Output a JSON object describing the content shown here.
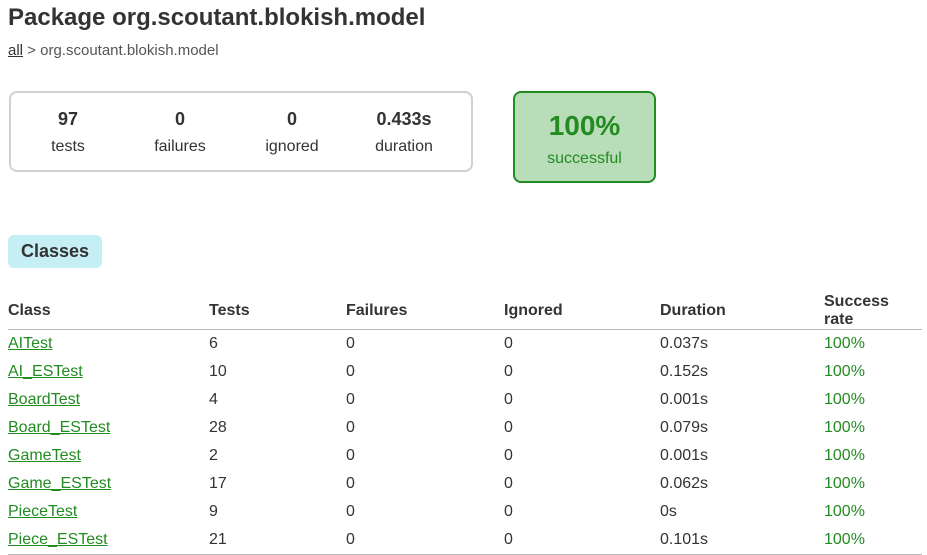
{
  "page": {
    "title": "Package org.scoutant.blokish.model",
    "breadcrumb": {
      "link": "all",
      "separator": " > ",
      "current": "org.scoutant.blokish.model"
    }
  },
  "summary": {
    "tests": {
      "value": "97",
      "label": "tests"
    },
    "failures": {
      "value": "0",
      "label": "failures"
    },
    "ignored": {
      "value": "0",
      "label": "ignored"
    },
    "duration": {
      "value": "0.433s",
      "label": "duration"
    },
    "success": {
      "value": "100%",
      "label": "successful"
    }
  },
  "tabs": [
    {
      "label": "Classes"
    }
  ],
  "table": {
    "headers": [
      "Class",
      "Tests",
      "Failures",
      "Ignored",
      "Duration",
      "Success rate"
    ],
    "rows": [
      [
        "AITest",
        "6",
        "0",
        "0",
        "0.037s",
        "100%"
      ],
      [
        "AI_ESTest",
        "10",
        "0",
        "0",
        "0.152s",
        "100%"
      ],
      [
        "BoardTest",
        "4",
        "0",
        "0",
        "0.001s",
        "100%"
      ],
      [
        "Board_ESTest",
        "28",
        "0",
        "0",
        "0.079s",
        "100%"
      ],
      [
        "GameTest",
        "2",
        "0",
        "0",
        "0.001s",
        "100%"
      ],
      [
        "Game_ESTest",
        "17",
        "0",
        "0",
        "0.062s",
        "100%"
      ],
      [
        "PieceTest",
        "9",
        "0",
        "0",
        "0s",
        "100%"
      ],
      [
        "Piece_ESTest",
        "21",
        "0",
        "0",
        "0.101s",
        "100%"
      ]
    ]
  },
  "colors": {
    "success_green": "#228b22",
    "success_bg": "#b9ddb9",
    "tab_bg": "#c5eef5"
  }
}
